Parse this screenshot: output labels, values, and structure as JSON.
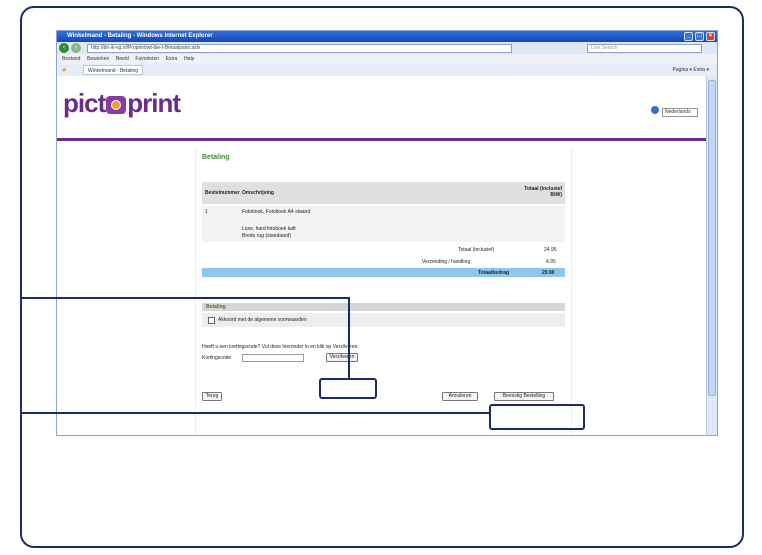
{
  "browser": {
    "window_title": "Winkelmand - Betaling - Windows Internet Explorer",
    "url": "http://bh-ik-vg.nl/Proprint/wt-lbe-t-Betaalpaint.asfx",
    "search_placeholder": "Live Search",
    "menu": [
      "Bestand",
      "Bewerken",
      "Beeld",
      "Favorieten",
      "Extra",
      "Help"
    ],
    "tab_label": "Winkelmand - Betaling",
    "tools_label": "Pagina ▾  Extra ▾"
  },
  "site": {
    "logo_left": "pict",
    "logo_right": "print",
    "language_label": "Nederlands"
  },
  "checkout": {
    "title": "Betaling",
    "headers": {
      "col1": "Bestelnummer",
      "col2": "Omschrijving",
      "col3": "Totaal (inclusief BtW)"
    },
    "order_number": "1",
    "order_line": "Fotoboek, Fotoboek A4 staand",
    "product_line1": "Luxe, hard fotoboek kaft",
    "product_line2": "Brede rug (standaard)",
    "subtotal_label": "Totaal (inclusief)",
    "subtotal_value": "24.95",
    "shipping_label": "Verzending / handling",
    "shipping_value": "4.95",
    "total_label": "Totaalbedrag",
    "total_value": "29.90",
    "payment_section": "Betaling",
    "terms_label": "Akkoord met de algemene voorwaarden",
    "promo_text": "Heeft u een kortingscode? Vul deze hieronder in en klik op Verzilveren.",
    "promo_label": "Kortingscode",
    "redeem_button": "Verzilveren",
    "back_button": "Terug",
    "cancel_button": "Annuleren",
    "confirm_button": "Bevestig Bestelling"
  }
}
